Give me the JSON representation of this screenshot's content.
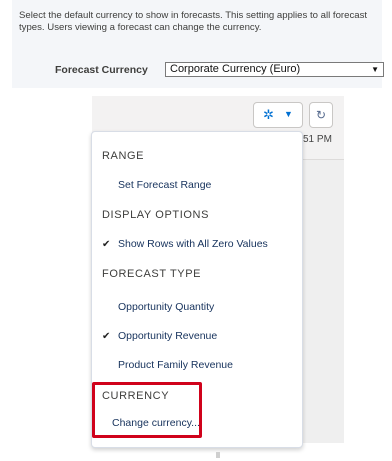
{
  "settings": {
    "description": "Select the default currency to show in forecasts. This setting applies to all forecast types. Users viewing a forecast can change the currency.",
    "currency_label": "Forecast Currency",
    "currency_value": "Corporate Currency (Euro)"
  },
  "toolbar": {
    "gear_icon": "gear-icon",
    "refresh_icon": "refresh-icon",
    "time_partial": "51 PM"
  },
  "menu": {
    "range_heading": "RANGE",
    "set_range": "Set Forecast Range",
    "display_heading": "DISPLAY OPTIONS",
    "show_zero_rows": "Show Rows with All Zero Values",
    "type_heading": "FORECAST TYPE",
    "opp_quantity": "Opportunity Quantity",
    "opp_revenue": "Opportunity Revenue",
    "product_family": "Product Family Revenue",
    "currency_heading": "CURRENCY",
    "change_currency": "Change currency..."
  },
  "colors": {
    "accent": "#0070d2",
    "highlight": "#d0021b"
  }
}
